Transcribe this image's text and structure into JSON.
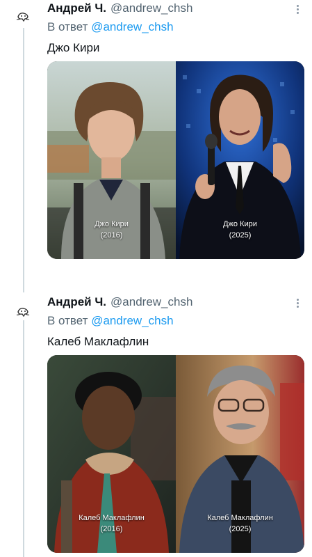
{
  "tweets": [
    {
      "author_name": "Андрей Ч.",
      "author_handle": "@andrew_chsh",
      "reply_prefix": "В ответ",
      "reply_to": "@andrew_chsh",
      "text": "Джо Кири",
      "images": [
        {
          "caption_name": "Джо Кири",
          "caption_year": "(2016)"
        },
        {
          "caption_name": "Джо Кири",
          "caption_year": "(2025)"
        }
      ]
    },
    {
      "author_name": "Андрей Ч.",
      "author_handle": "@andrew_chsh",
      "reply_prefix": "В ответ",
      "reply_to": "@andrew_chsh",
      "text": "Калеб Маклафлин",
      "images": [
        {
          "caption_name": "Калеб Маклафлин",
          "caption_year": "(2016)"
        },
        {
          "caption_name": "Калеб Маклафлин",
          "caption_year": "(2025)"
        }
      ]
    }
  ],
  "icons": {
    "avatar": "avatar-icon",
    "more": "more-options-icon"
  },
  "colors": {
    "link": "#1d9bf0",
    "secondary_text": "#536471",
    "thread_line": "#cfd9de"
  }
}
